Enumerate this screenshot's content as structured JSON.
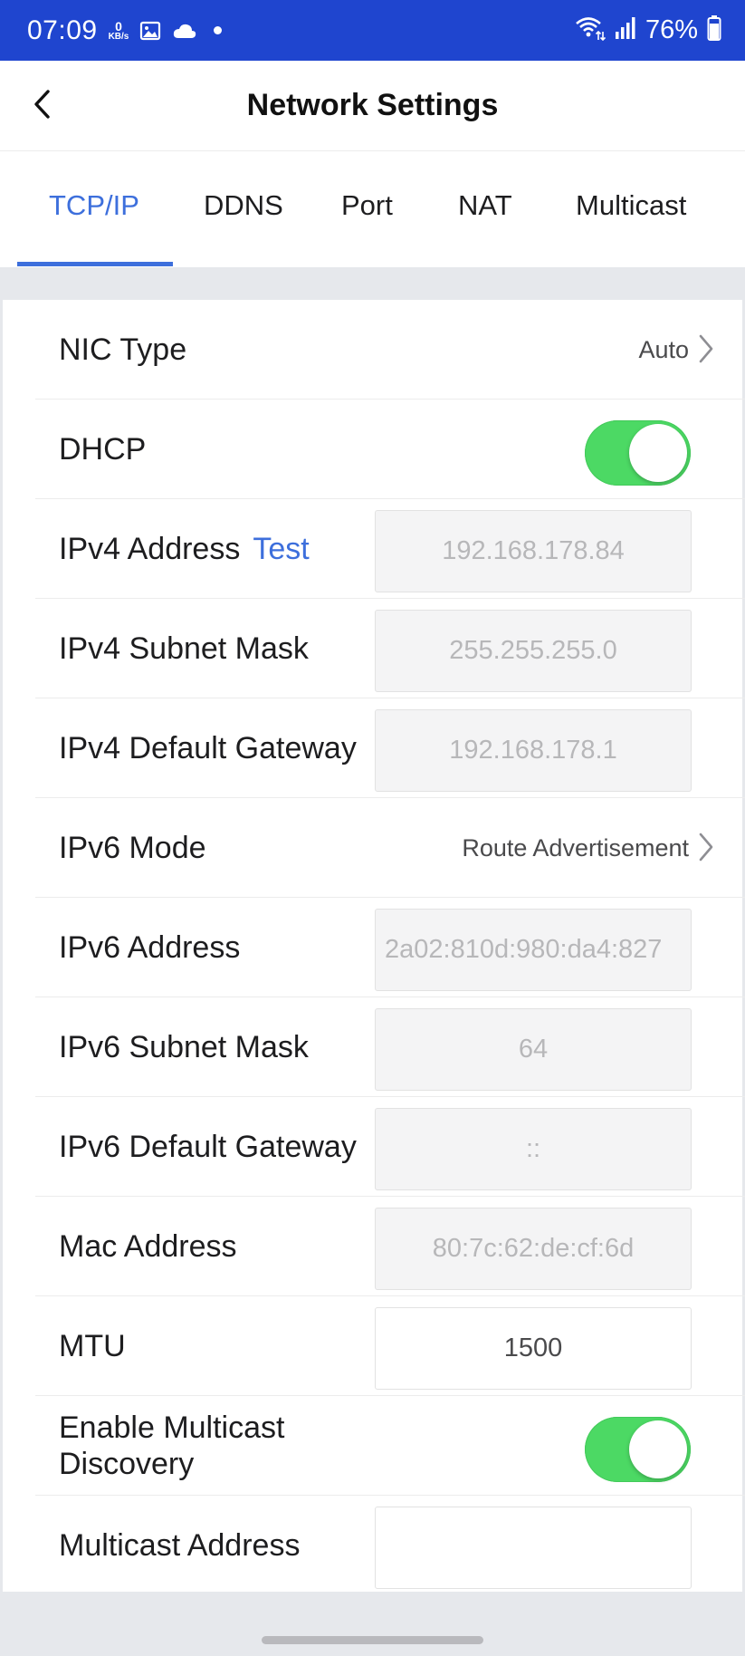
{
  "status_bar": {
    "time": "07:09",
    "net_speed_value": "0",
    "net_speed_unit": "KB/s",
    "battery_text": "76%",
    "icons": [
      "gallery-icon",
      "cloud-icon",
      "notification-dot-icon",
      "wifi-icon",
      "signal-icon",
      "battery-icon"
    ],
    "background_color": "#1f45cf"
  },
  "header": {
    "title": "Network Settings",
    "back_icon": "chevron-left-icon"
  },
  "tabs": [
    {
      "label": "TCP/IP",
      "active": true
    },
    {
      "label": "DDNS",
      "active": false
    },
    {
      "label": "Port",
      "active": false
    },
    {
      "label": "NAT",
      "active": false
    },
    {
      "label": "Multicast",
      "active": false
    }
  ],
  "accent_color": "#3d6fdc",
  "toggle_color": "#4cd964",
  "settings": {
    "nic_type": {
      "label": "NIC Type",
      "value": "Auto"
    },
    "dhcp": {
      "label": "DHCP",
      "enabled": true
    },
    "ipv4_address": {
      "label": "IPv4 Address",
      "link": "Test",
      "value": "192.168.178.84"
    },
    "ipv4_subnet_mask": {
      "label": "IPv4 Subnet Mask",
      "value": "255.255.255.0"
    },
    "ipv4_default_gateway": {
      "label": "IPv4 Default Gateway",
      "value": "192.168.178.1"
    },
    "ipv6_mode": {
      "label": "IPv6 Mode",
      "value": "Route Advertisement"
    },
    "ipv6_address": {
      "label": "IPv6 Address",
      "value": "2a02:810d:980:da4:827"
    },
    "ipv6_subnet_mask": {
      "label": "IPv6 Subnet Mask",
      "value": "64"
    },
    "ipv6_default_gateway": {
      "label": "IPv6 Default Gateway",
      "value": "::"
    },
    "mac_address": {
      "label": "Mac Address",
      "value": "80:7c:62:de:cf:6d"
    },
    "mtu": {
      "label": "MTU",
      "value": "1500"
    },
    "multicast_discovery": {
      "label": "Enable Multicast Discovery",
      "enabled": true
    },
    "multicast_address": {
      "label": "Multicast Address",
      "value": ""
    }
  }
}
